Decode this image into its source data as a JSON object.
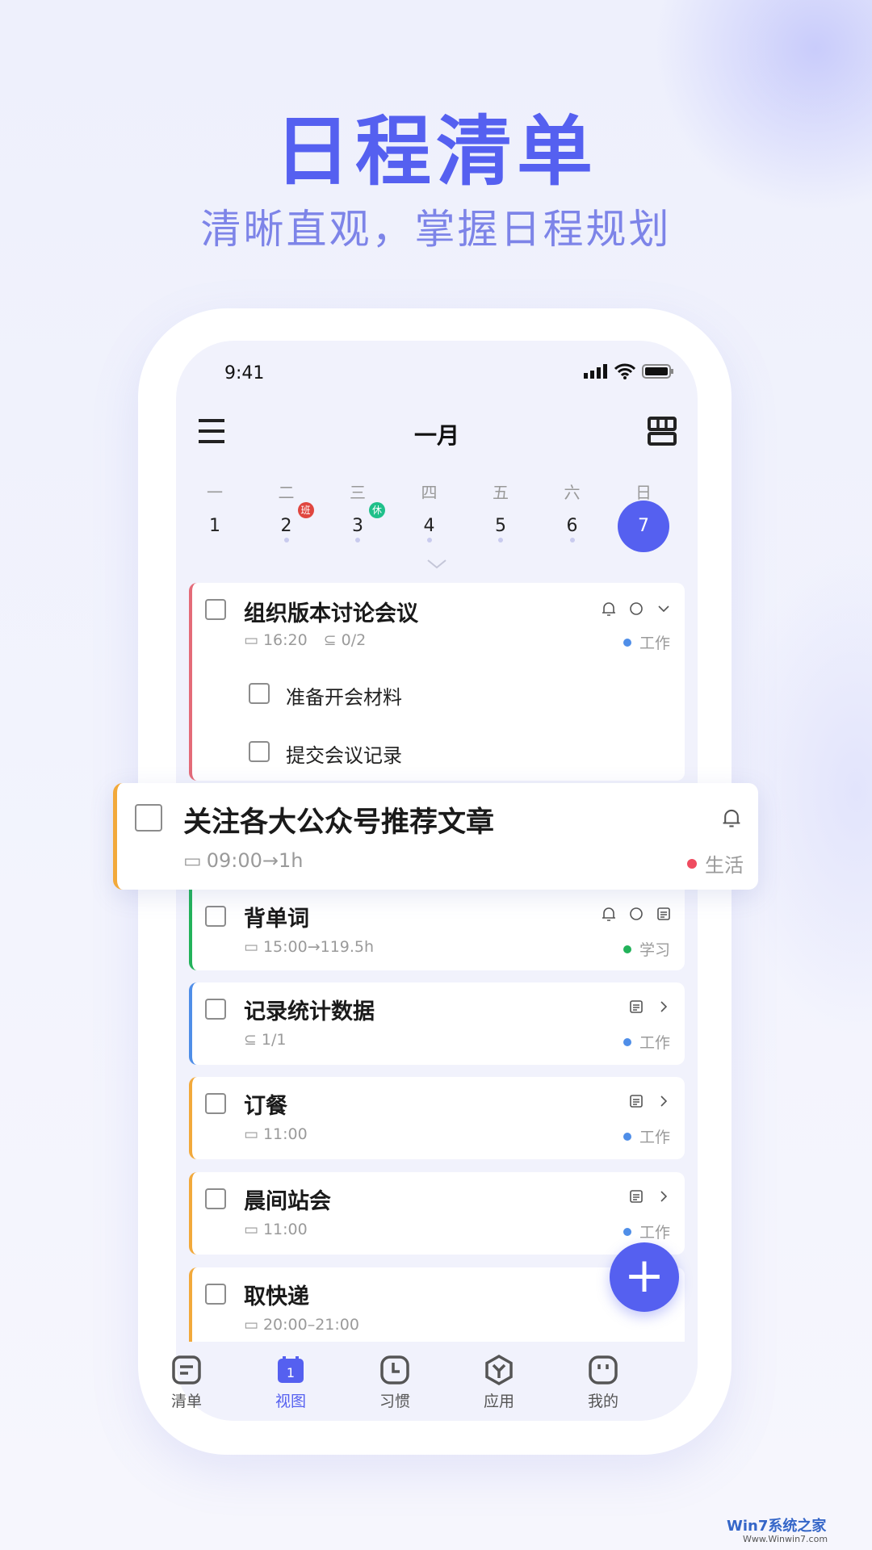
{
  "hero": {
    "title": "日程清单",
    "subtitle": "清晰直观，掌握日程规划"
  },
  "status_bar": {
    "time": "9:41"
  },
  "header": {
    "month": "一月"
  },
  "calendar": {
    "weekdays": [
      "一",
      "二",
      "三",
      "四",
      "五",
      "六",
      "日"
    ],
    "dates": [
      "1",
      "2",
      "3",
      "4",
      "5",
      "6",
      "7"
    ],
    "selected": "7",
    "badges": {
      "work": "班",
      "rest": "休"
    }
  },
  "colors": {
    "accent": "#5560f0",
    "work": "#4f8ee8",
    "life": "#ef4b5f",
    "study": "#22b25a",
    "badge_work": "#e0463f",
    "badge_rest": "#1fc08a"
  },
  "tasks": [
    {
      "title": "组织版本讨论会议",
      "time": "16:20",
      "subtasks": "0/2",
      "tag": "工作",
      "children": [
        "准备开会材料",
        "提交会议记录"
      ]
    },
    {
      "title": "关注各大公众号推荐文章",
      "time": "09:00→1h",
      "tag": "生活"
    },
    {
      "title": "背单词",
      "time": "15:00→119.5h",
      "tag": "学习"
    },
    {
      "title": "记录统计数据",
      "subtasks": "1/1",
      "tag": "工作"
    },
    {
      "title": "订餐",
      "time": "11:00",
      "tag": "工作"
    },
    {
      "title": "晨间站会",
      "time": "11:00",
      "tag": "工作"
    },
    {
      "title": "取快递",
      "time": "20:00–21:00"
    }
  ],
  "fab": {
    "label": "+"
  },
  "tabbar": [
    {
      "label": "清单"
    },
    {
      "label": "视图",
      "badge": "1"
    },
    {
      "label": "习惯"
    },
    {
      "label": "应用"
    },
    {
      "label": "我的"
    }
  ],
  "watermark": {
    "text": "Win7系统之家",
    "url_text": "Www.Winwin7.com"
  }
}
